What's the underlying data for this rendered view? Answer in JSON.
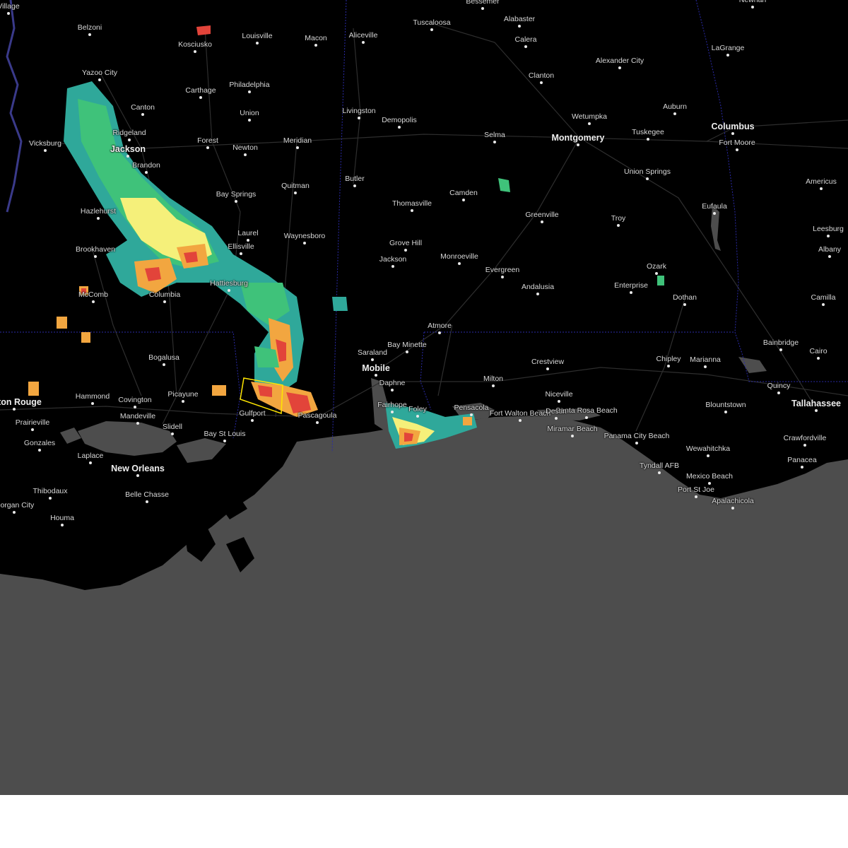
{
  "map": {
    "colors": {
      "land": "#000000",
      "water": "#4d4d4d",
      "roads": "#2e2e2e",
      "state_border": "#2a2aa8",
      "warning_polygon": "#ffe600",
      "radar_light": "#2fa89a",
      "radar_green": "#3fc27a",
      "radar_yellow": "#f5f07a",
      "radar_orange": "#f2a640",
      "radar_red": "#e2443a"
    },
    "cities": [
      {
        "name": "Bessemer",
        "major": false
      },
      {
        "name": "Newnan",
        "major": false
      },
      {
        "name": "Tuscaloosa",
        "major": false
      },
      {
        "name": "Alabaster",
        "major": false
      },
      {
        "name": "Belzoni",
        "major": false
      },
      {
        "name": "Louisville",
        "major": false
      },
      {
        "name": "Macon",
        "major": false
      },
      {
        "name": "Aliceville",
        "major": false
      },
      {
        "name": "Calera",
        "major": false
      },
      {
        "name": "LaGrange",
        "major": false
      },
      {
        "name": "Kosciusko",
        "major": false
      },
      {
        "name": "Alexander City",
        "major": false
      },
      {
        "name": "Yazoo City",
        "major": false
      },
      {
        "name": "Clanton",
        "major": false
      },
      {
        "name": "Philadelphia",
        "major": false
      },
      {
        "name": "Carthage",
        "major": false
      },
      {
        "name": "Canton",
        "major": false
      },
      {
        "name": "Livingston",
        "major": false
      },
      {
        "name": "Union",
        "major": false
      },
      {
        "name": "Auburn",
        "major": false
      },
      {
        "name": "Wetumpka",
        "major": false
      },
      {
        "name": "Demopolis",
        "major": false
      },
      {
        "name": "Columbus",
        "major": true
      },
      {
        "name": "Ridgeland",
        "major": false
      },
      {
        "name": "Tuskegee",
        "major": false
      },
      {
        "name": "Selma",
        "major": false
      },
      {
        "name": "Montgomery",
        "major": true
      },
      {
        "name": "Vicksburg",
        "major": false
      },
      {
        "name": "Forest",
        "major": false
      },
      {
        "name": "Meridian",
        "major": false
      },
      {
        "name": "Fort Moore",
        "major": false
      },
      {
        "name": "Newton",
        "major": false
      },
      {
        "name": "Jackson",
        "major": true
      },
      {
        "name": "Brandon",
        "major": false
      },
      {
        "name": "Union Springs",
        "major": false
      },
      {
        "name": "Butler",
        "major": false
      },
      {
        "name": "Americus",
        "major": false
      },
      {
        "name": "Quitman",
        "major": false
      },
      {
        "name": "Bay Springs",
        "major": false
      },
      {
        "name": "Camden",
        "major": false
      },
      {
        "name": "Thomasville",
        "major": false
      },
      {
        "name": "Eufaula",
        "major": false
      },
      {
        "name": "Hazlehurst",
        "major": false
      },
      {
        "name": "Greenville",
        "major": false
      },
      {
        "name": "Troy",
        "major": false
      },
      {
        "name": "Leesburg",
        "major": false
      },
      {
        "name": "Laurel",
        "major": false
      },
      {
        "name": "Waynesboro",
        "major": false
      },
      {
        "name": "Ellisville",
        "major": false
      },
      {
        "name": "Grove Hill",
        "major": false
      },
      {
        "name": "Brookhaven",
        "major": false
      },
      {
        "name": "Albany",
        "major": false
      },
      {
        "name": "Monroeville",
        "major": false
      },
      {
        "name": "Jackson",
        "major": false
      },
      {
        "name": "Ozark",
        "major": false
      },
      {
        "name": "Evergreen",
        "major": false
      },
      {
        "name": "Hattiesburg",
        "major": false
      },
      {
        "name": "Enterprise",
        "major": false
      },
      {
        "name": "Andalusia",
        "major": false
      },
      {
        "name": "McComb",
        "major": false
      },
      {
        "name": "Columbia",
        "major": false
      },
      {
        "name": "Dothan",
        "major": false
      },
      {
        "name": "Camilla",
        "major": false
      },
      {
        "name": "Atmore",
        "major": false
      },
      {
        "name": "Bainbridge",
        "major": false
      },
      {
        "name": "Bay Minette",
        "major": false
      },
      {
        "name": "Cairo",
        "major": false
      },
      {
        "name": "Saraland",
        "major": false
      },
      {
        "name": "Bogalusa",
        "major": false
      },
      {
        "name": "Chipley",
        "major": false
      },
      {
        "name": "Marianna",
        "major": false
      },
      {
        "name": "Crestview",
        "major": false
      },
      {
        "name": "Mobile",
        "major": true
      },
      {
        "name": "Milton",
        "major": false
      },
      {
        "name": "Daphne",
        "major": false
      },
      {
        "name": "Quincy",
        "major": false
      },
      {
        "name": "Hammond",
        "major": false
      },
      {
        "name": "Picayune",
        "major": false
      },
      {
        "name": "Niceville",
        "major": false
      },
      {
        "name": "Covington",
        "major": false
      },
      {
        "name": "Baton Rouge",
        "major": true
      },
      {
        "name": "Blountstown",
        "major": false
      },
      {
        "name": "Tallahassee",
        "major": true
      },
      {
        "name": "Fairhope",
        "major": false
      },
      {
        "name": "Pensacola",
        "major": false
      },
      {
        "name": "Santa Rosa Beach",
        "major": false
      },
      {
        "name": "Foley",
        "major": false
      },
      {
        "name": "Fort Walton Beach",
        "major": false
      },
      {
        "name": "Destin",
        "major": false
      },
      {
        "name": "Gulfport",
        "major": false
      },
      {
        "name": "Mandeville",
        "major": false
      },
      {
        "name": "Pascagoula",
        "major": false
      },
      {
        "name": "Prairieville",
        "major": false
      },
      {
        "name": "Slidell",
        "major": false
      },
      {
        "name": "Bay St Louis",
        "major": false
      },
      {
        "name": "Miramar Beach",
        "major": false
      },
      {
        "name": "Panama City Beach",
        "major": false
      },
      {
        "name": "Crawfordville",
        "major": false
      },
      {
        "name": "Gonzales",
        "major": false
      },
      {
        "name": "Wewahitchka",
        "major": false
      },
      {
        "name": "Laplace",
        "major": false
      },
      {
        "name": "Panacea",
        "major": false
      },
      {
        "name": "Tyndall AFB",
        "major": false
      },
      {
        "name": "New Orleans",
        "major": true
      },
      {
        "name": "Mexico Beach",
        "major": false
      },
      {
        "name": "Thibodaux",
        "major": false
      },
      {
        "name": "Belle Chasse",
        "major": false
      },
      {
        "name": "Port St Joe",
        "major": false
      },
      {
        "name": "Apalachicola",
        "major": false
      },
      {
        "name": "Morgan City",
        "major": false
      },
      {
        "name": "Houma",
        "major": false
      },
      {
        "name": "Village",
        "major": false
      }
    ]
  }
}
